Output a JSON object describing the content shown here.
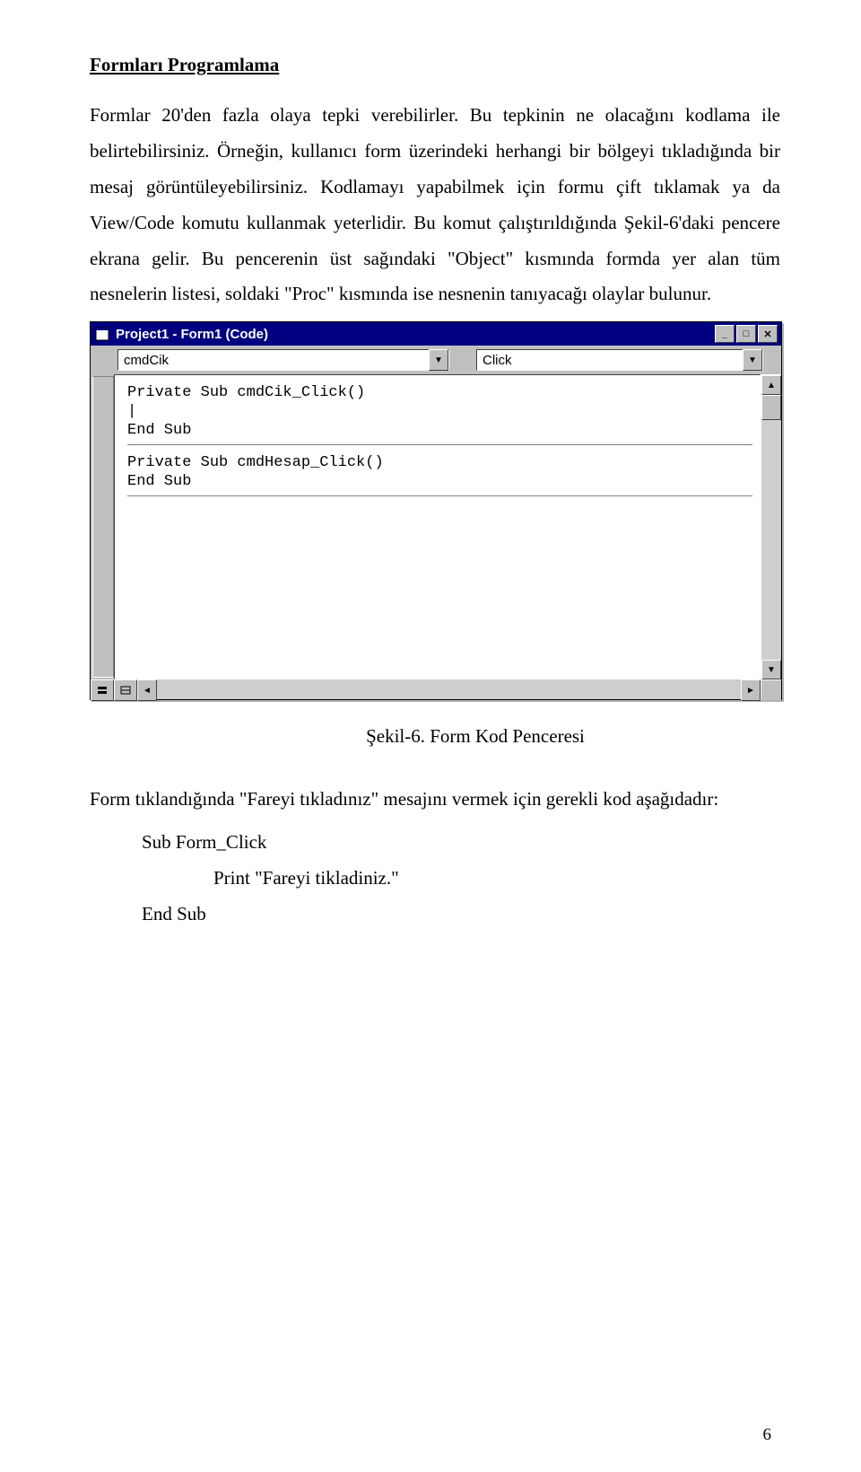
{
  "heading": "Formları Programlama",
  "para1": "Formlar 20'den fazla olaya tepki verebilirler. Bu tepkinin ne olacağını kodlama ile belirtebilirsiniz. Örneğin, kullanıcı form üzerindeki herhangi bir bölgeyi tıkladığında bir mesaj görüntüleyebilirsiniz. Kodlamayı yapabilmek için formu çift tıklamak ya da View/Code komutu kullanmak yeterlidir. Bu komut çalıştırıldığında Şekil-6'daki pencere ekrana gelir. Bu pencerenin üst sağındaki \"Object\" kısmında formda yer alan tüm nesnelerin listesi, soldaki \"Proc\" kısmında ise nesnenin tanıyacağı olaylar bulunur.",
  "ide": {
    "title": "Project1 - Form1 (Code)",
    "object_combo": "cmdCik",
    "proc_combo": "Click",
    "code_lines_block1": [
      "Private Sub cmdCik_Click()",
      "|",
      "End Sub"
    ],
    "code_lines_block2": [
      "Private Sub cmdHesap_Click()",
      "",
      "End Sub"
    ]
  },
  "caption": "Şekil-6. Form Kod Penceresi",
  "para2": "Form tıklandığında \"Fareyi tıkladınız\" mesajını vermek için gerekli kod aşağıdadır:",
  "codeblock": {
    "l1": "Sub Form_Click",
    "l2": "Print \"Fareyi tikladiniz.\"",
    "l3": "End Sub"
  },
  "page_number": "6"
}
